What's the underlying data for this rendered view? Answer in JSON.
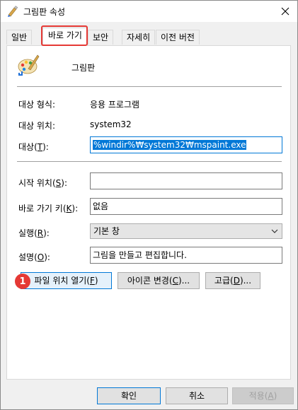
{
  "window": {
    "title": "그림판 속성",
    "close_icon": "close-icon",
    "title_icon": "paint-icon"
  },
  "tabs": [
    "일반",
    "바로 가기",
    "보안",
    "자세히",
    "이전 버전"
  ],
  "active_tab": "바로 가기",
  "app": {
    "name": "그림판",
    "icon": "paint-palette-icon"
  },
  "target_type": {
    "label": "대상 형식:",
    "value": "응용 프로그램"
  },
  "target_location": {
    "label": "대상 위치:",
    "value": "system32"
  },
  "target": {
    "label_pre": "대상(",
    "label_key": "T",
    "label_post": "):",
    "value": "%windir%₩system32₩mspaint.exe"
  },
  "start_in": {
    "label_pre": "시작 위치(",
    "label_key": "S",
    "label_post": "):",
    "value": ""
  },
  "shortcut_key": {
    "label_pre": "바로 가기 키(",
    "label_key": "K",
    "label_post": "):",
    "value": "없음"
  },
  "run": {
    "label_pre": "실행(",
    "label_key": "R",
    "label_post": "):",
    "value": "기본 창"
  },
  "comment": {
    "label_pre": "설명(",
    "label_key": "O",
    "label_post": "):",
    "value": "그림을 만들고 편집합니다."
  },
  "buttons": {
    "open_location_pre": "파일 위치 열기(",
    "open_location_key": "F",
    "open_location_post": ")",
    "change_icon_pre": "아이콘 변경(",
    "change_icon_key": "C",
    "change_icon_post": ")...",
    "advanced_pre": "고급(",
    "advanced_key": "D",
    "advanced_post": ")...",
    "ok": "확인",
    "cancel": "취소",
    "apply_pre": "적용(",
    "apply_key": "A",
    "apply_post": ")"
  },
  "annotation": {
    "badge": "1",
    "color": "#e53935"
  },
  "colors": {
    "accent": "#0078d7",
    "highlight": "#e53935"
  }
}
